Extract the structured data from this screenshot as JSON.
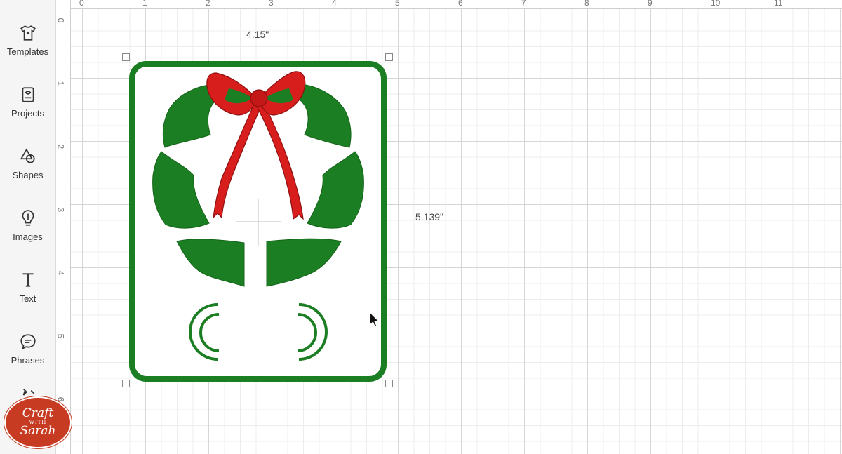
{
  "sidebar": {
    "items": [
      {
        "label": "Templates",
        "icon": "tshirt-icon"
      },
      {
        "label": "Projects",
        "icon": "projects-icon"
      },
      {
        "label": "Shapes",
        "icon": "shapes-icon"
      },
      {
        "label": "Images",
        "icon": "lightbulb-icon"
      },
      {
        "label": "Text",
        "icon": "text-icon"
      },
      {
        "label": "Phrases",
        "icon": "speech-bubble-icon"
      }
    ],
    "brand": {
      "line1": "Craft",
      "line2": "WITH",
      "line3": "Sarah"
    }
  },
  "ruler": {
    "top": [
      "0",
      "1",
      "2",
      "3",
      "4",
      "5",
      "6",
      "7",
      "8",
      "9",
      "10",
      "11"
    ],
    "left": [
      "0",
      "1",
      "2",
      "3",
      "4",
      "5",
      "6"
    ]
  },
  "dimensions": {
    "width": "4.15\"",
    "height": "5.139\""
  },
  "colors": {
    "green": "#1b7e22",
    "red": "#d81d1d",
    "canvas_grid": "#d6d6d6"
  }
}
